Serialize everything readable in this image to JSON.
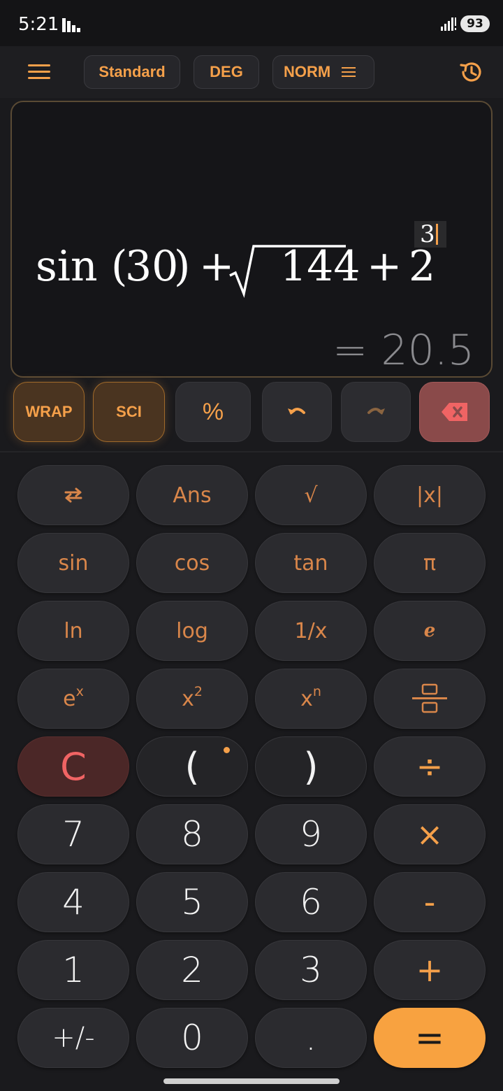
{
  "status": {
    "time": "5:21",
    "battery": "93"
  },
  "toolbar": {
    "mode": "Standard",
    "angle": "DEG",
    "format": "NORM"
  },
  "display": {
    "expr_sin": "sin",
    "expr_open": "(",
    "expr_30": "30",
    "expr_close": ")",
    "expr_plus1": "+",
    "expr_sqrt_arg": "144",
    "expr_plus2": "+",
    "expr_base": "2",
    "exponent": "3",
    "result": "= 20.5"
  },
  "actions": {
    "wrap": "WRAP",
    "sci": "SCI",
    "percent": "%"
  },
  "keys": {
    "ans": "Ans",
    "sqrt": "√",
    "abs": "|x|",
    "sin": "sin",
    "cos": "cos",
    "tan": "tan",
    "pi": "π",
    "ln": "ln",
    "log": "log",
    "recip": "1/x",
    "e": "e",
    "exp_base": "e",
    "exp_sup": "x",
    "sq_base": "x",
    "sq_sup": "2",
    "pow_base": "x",
    "pow_sup": "n",
    "clear": "C",
    "lparen": "(",
    "rparen": ")",
    "divide": "÷",
    "n7": "7",
    "n8": "8",
    "n9": "9",
    "multiply": "×",
    "n4": "4",
    "n5": "5",
    "n6": "6",
    "minus": "-",
    "n1": "1",
    "n2": "2",
    "n3": "3",
    "plus": "+",
    "negate": "+/-",
    "n0": "0",
    "dot": ".",
    "equals": "="
  },
  "colors": {
    "accent": "#f5a04a",
    "background": "#1a1a1d",
    "clear": "#f06464"
  }
}
